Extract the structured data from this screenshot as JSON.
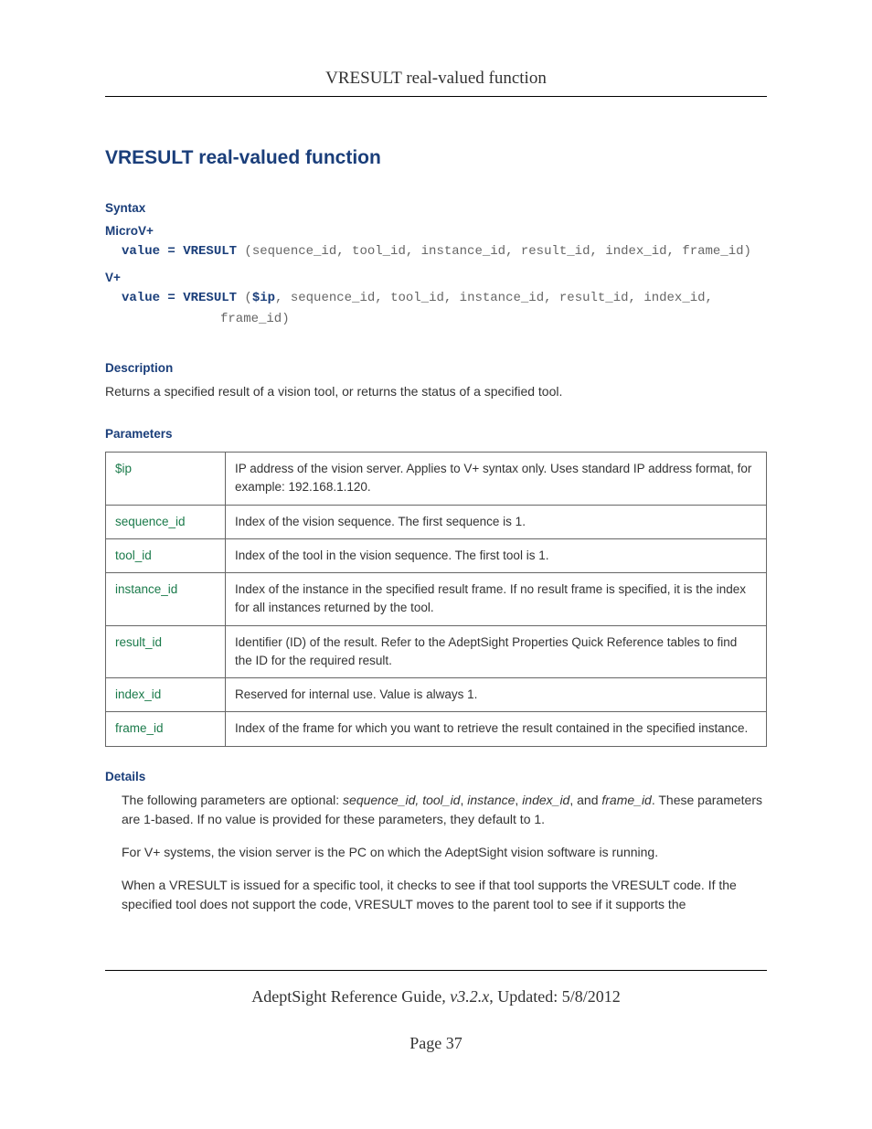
{
  "header": {
    "title": "VRESULT real-valued function"
  },
  "title": "VRESULT real-valued function",
  "syntax": {
    "heading": "Syntax",
    "microv": {
      "label": "MicroV+",
      "lhs": "value = VRESULT ",
      "args": "(sequence_id, tool_id, instance_id, result_id, index_id, frame_id)"
    },
    "vplus": {
      "label": "V+",
      "lhs": "value = VRESULT ",
      "ip_open": "(",
      "ip": "$ip",
      "args1": ", sequence_id, tool_id, instance_id, result_id, index_id,",
      "args2": "frame_id)"
    }
  },
  "description": {
    "heading": "Description",
    "text": "Returns a specified result of a vision tool, or returns the status of a specified tool."
  },
  "parameters": {
    "heading": "Parameters",
    "rows": [
      {
        "name": "$ip",
        "desc": "IP address of the vision server. Applies to V+ syntax only. Uses standard IP address format, for example: 192.168.1.120."
      },
      {
        "name": "sequence_id",
        "desc": "Index of the vision sequence. The first sequence is 1."
      },
      {
        "name": "tool_id",
        "desc": "Index of the tool in the vision sequence. The first tool is 1."
      },
      {
        "name": "instance_id",
        "desc": "Index of the instance in the specified result frame. If no result frame is specified, it is the index for all instances returned by the tool."
      },
      {
        "name": "result_id",
        "desc": "Identifier (ID) of the result. Refer to the AdeptSight Properties Quick Reference tables to find the ID for the required result."
      },
      {
        "name": "index_id",
        "desc": "Reserved for internal use. Value is always 1."
      },
      {
        "name": "frame_id",
        "desc": "Index of the frame for which you want to retrieve the result contained in the specified instance."
      }
    ]
  },
  "details": {
    "heading": "Details",
    "p1_a": "The following parameters are optional: ",
    "p1_i1": "sequence_id, tool_id",
    "p1_b": ", ",
    "p1_i2": "instance",
    "p1_c": ", ",
    "p1_i3": "index_id",
    "p1_d": ", and ",
    "p1_i4": "frame_id",
    "p1_e": ". These parameters are 1-based. If no value is provided for these parameters, they default to 1.",
    "p2": "For V+ systems, the vision server is the PC on which the AdeptSight vision software is running.",
    "p3": "When a VRESULT is issued for a specific tool, it checks to see if that tool supports the VRESULT code. If the specified tool does not support the code, VRESULT moves to the parent tool to see if it supports the"
  },
  "footer": {
    "doc": "AdeptSight Reference Guide",
    "version": ", v3.2.x",
    "updated": ", Updated: 5/8/2012",
    "page": "Page 37"
  }
}
